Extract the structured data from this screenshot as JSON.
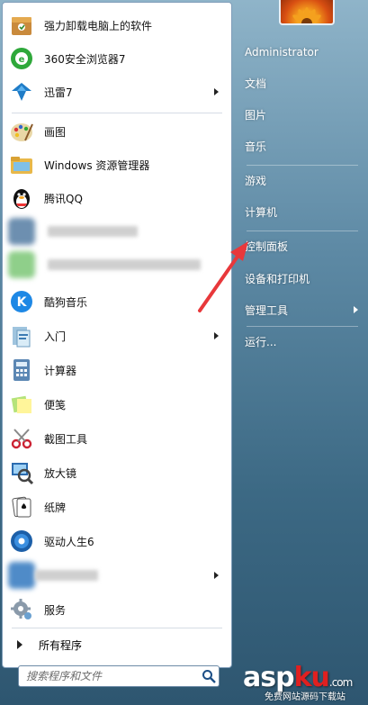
{
  "left_programs": [
    {
      "label": "强力卸载电脑上的软件",
      "icon": "uninstall-box-icon",
      "arrow": false
    },
    {
      "label": "360安全浏览器7",
      "icon": "360-browser-icon",
      "arrow": false
    },
    {
      "label": "迅雷7",
      "icon": "thunder-bird-icon",
      "arrow": true
    },
    {
      "label": "画图",
      "icon": "paint-palette-icon",
      "arrow": false
    },
    {
      "label": "Windows 资源管理器",
      "icon": "folder-explorer-icon",
      "arrow": false
    },
    {
      "label": "腾讯QQ",
      "icon": "qq-penguin-icon",
      "arrow": false
    },
    {
      "label": "",
      "icon": "blurred-icon",
      "arrow": false
    },
    {
      "label": "",
      "icon": "blurred-icon",
      "arrow": false
    },
    {
      "label": "酷狗音乐",
      "icon": "kugou-icon",
      "arrow": false
    },
    {
      "label": "入门",
      "icon": "getting-started-icon",
      "arrow": true
    },
    {
      "label": "计算器",
      "icon": "calculator-icon",
      "arrow": false
    },
    {
      "label": "便笺",
      "icon": "sticky-notes-icon",
      "arrow": false
    },
    {
      "label": "截图工具",
      "icon": "snipping-tool-icon",
      "arrow": false
    },
    {
      "label": "放大镜",
      "icon": "magnifier-icon",
      "arrow": false
    },
    {
      "label": "纸牌",
      "icon": "solitaire-icon",
      "arrow": false
    },
    {
      "label": "驱动人生6",
      "icon": "driver-life-icon",
      "arrow": false
    },
    {
      "label": "",
      "icon": "blurred-icon",
      "arrow": true
    },
    {
      "label": "服务",
      "icon": "services-gear-icon",
      "arrow": false
    }
  ],
  "all_programs": "所有程序",
  "search": {
    "placeholder": "搜索程序和文件"
  },
  "right_items": [
    {
      "label": "Administrator",
      "arrow": false
    },
    {
      "label": "文档",
      "arrow": false
    },
    {
      "label": "图片",
      "arrow": false
    },
    {
      "label": "音乐",
      "arrow": false
    },
    {
      "label": "游戏",
      "arrow": false
    },
    {
      "label": "计算机",
      "arrow": false
    },
    {
      "label": "控制面板",
      "arrow": false
    },
    {
      "label": "设备和打印机",
      "arrow": false
    },
    {
      "label": "管理工具",
      "arrow": true
    },
    {
      "label": "运行...",
      "arrow": false
    }
  ],
  "watermark": {
    "logo_main": "asp",
    "logo_highlight": "ku",
    "logo_tail": ".com",
    "subtitle": "免费网站源码下载站"
  },
  "colors": {
    "accent_arrow": "#e8383b",
    "menu_blue": "#3c6984"
  }
}
